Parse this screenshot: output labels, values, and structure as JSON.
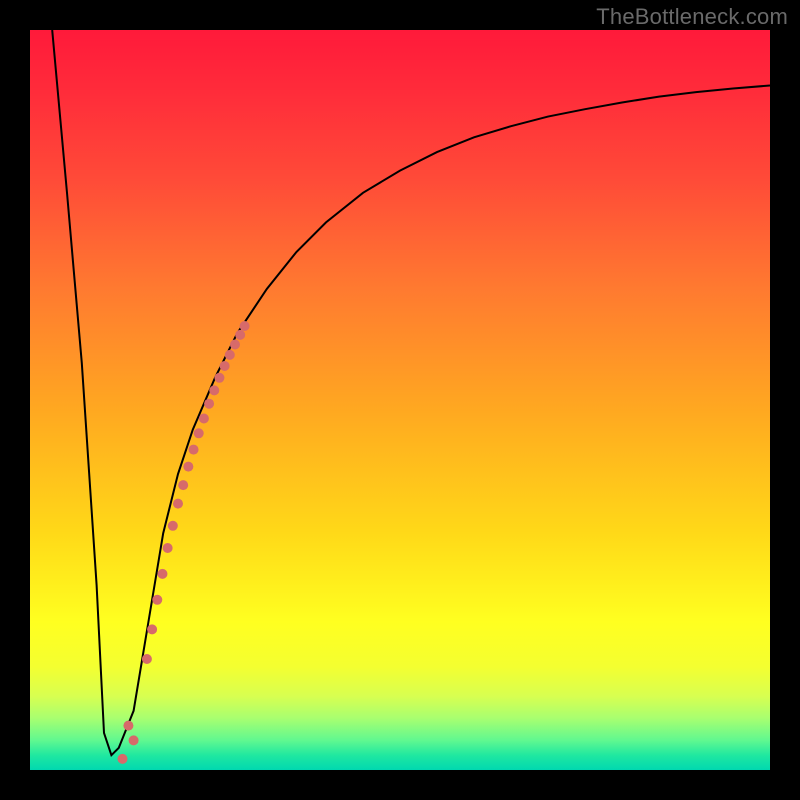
{
  "watermark": "TheBottleneck.com",
  "chart_data": {
    "type": "line",
    "title": "",
    "xlabel": "",
    "ylabel": "",
    "xlim": [
      0,
      100
    ],
    "ylim": [
      0,
      100
    ],
    "background_gradient": {
      "stops": [
        {
          "pos": 0,
          "color": "#ff1a3a"
        },
        {
          "pos": 8,
          "color": "#ff2b3a"
        },
        {
          "pos": 20,
          "color": "#ff4a38"
        },
        {
          "pos": 35,
          "color": "#ff7a30"
        },
        {
          "pos": 52,
          "color": "#ffaa20"
        },
        {
          "pos": 68,
          "color": "#ffd918"
        },
        {
          "pos": 80,
          "color": "#ffff20"
        },
        {
          "pos": 86,
          "color": "#f4ff30"
        },
        {
          "pos": 90,
          "color": "#d8ff50"
        },
        {
          "pos": 93,
          "color": "#a8ff70"
        },
        {
          "pos": 96,
          "color": "#60f890"
        },
        {
          "pos": 98,
          "color": "#20e8a0"
        },
        {
          "pos": 100,
          "color": "#00d8b0"
        }
      ]
    },
    "series": [
      {
        "name": "bottleneck-curve",
        "color": "#000000",
        "stroke_width": 2,
        "x": [
          3,
          5,
          7,
          9,
          10,
          11,
          12,
          14,
          16,
          18,
          20,
          22,
          25,
          28,
          32,
          36,
          40,
          45,
          50,
          55,
          60,
          65,
          70,
          75,
          80,
          85,
          90,
          95,
          100
        ],
        "y": [
          100,
          78,
          55,
          25,
          5,
          2,
          3,
          8,
          20,
          32,
          40,
          46,
          53,
          59,
          65,
          70,
          74,
          78,
          81,
          83.5,
          85.5,
          87,
          88.3,
          89.3,
          90.2,
          91,
          91.6,
          92.1,
          92.5
        ]
      }
    ],
    "highlight_points": {
      "name": "highlight-segment",
      "color": "#d76a6a",
      "radius": 5,
      "x": [
        14.0,
        15.8,
        16.5,
        17.2,
        17.9,
        18.6,
        19.3,
        20.0,
        20.7,
        21.4,
        22.1,
        22.8,
        23.5,
        24.2,
        24.9,
        25.6,
        26.3,
        27.0,
        27.7,
        28.4,
        29.0
      ],
      "y": [
        4.0,
        15.0,
        19.0,
        23.0,
        26.5,
        30.0,
        33.0,
        36.0,
        38.5,
        41.0,
        43.3,
        45.5,
        47.5,
        49.5,
        51.3,
        53.0,
        54.6,
        56.1,
        57.5,
        58.8,
        60.0
      ]
    },
    "isolated_points": {
      "color": "#d76a6a",
      "radius": 5,
      "x": [
        12.5,
        13.3
      ],
      "y": [
        1.5,
        6.0
      ]
    }
  }
}
